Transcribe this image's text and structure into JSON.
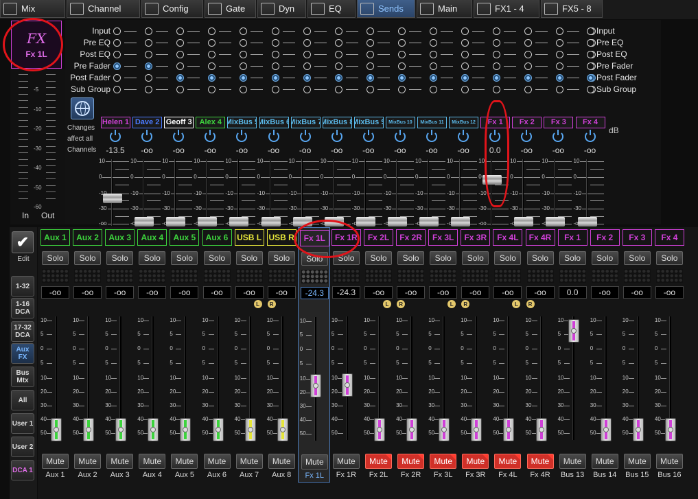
{
  "tabs": [
    {
      "label": "Mix",
      "icon": "mixer-icon"
    },
    {
      "label": "Channel",
      "icon": "channel-icon"
    },
    {
      "label": "Config",
      "icon": "input-icon"
    },
    {
      "label": "Gate",
      "icon": "gate-icon"
    },
    {
      "label": "Dyn",
      "icon": "dynamics-icon"
    },
    {
      "label": "EQ",
      "icon": "eq-icon"
    },
    {
      "label": "Sends",
      "icon": "sends-icon",
      "active": true
    },
    {
      "label": "Main",
      "icon": "main-lr-icon"
    },
    {
      "label": "FX1 - 4",
      "icon": "fx-wave-icon"
    },
    {
      "label": "FX5 - 8",
      "icon": "fx-icon"
    }
  ],
  "selected_channel": {
    "logo": "FX",
    "name": "Fx 1L"
  },
  "meter": {
    "scale": [
      "-5",
      "-10",
      "-20",
      "-30",
      "-40",
      "-50",
      "-60"
    ],
    "in_label": "In",
    "out_label": "Out"
  },
  "taps": {
    "options": [
      "Input",
      "Pre EQ",
      "Post EQ",
      "Pre Fader",
      "Post Fader",
      "Sub Group"
    ],
    "columns": [
      3,
      3,
      4,
      4,
      4,
      4,
      4,
      4,
      4,
      4,
      4,
      4,
      4,
      4,
      4,
      4
    ],
    "right_selected": 4
  },
  "changes_note": "Changes affect all Channels",
  "send_scale": [
    "10",
    "0",
    "-10",
    "-30",
    "-oo"
  ],
  "db_unit": "dB",
  "sends": [
    {
      "name": "Helen 1",
      "color": "#d040d8",
      "bus": "Bus 1",
      "value": "-13.5",
      "level": 0.42
    },
    {
      "name": "Dave 2",
      "color": "#4a7aff",
      "bus": "Bus 2",
      "value": "-oo",
      "level": 0.05
    },
    {
      "name": "Geoff 3",
      "color": "#ffffff",
      "bus": "Bus 3",
      "value": "-oo",
      "level": 0.05
    },
    {
      "name": "Alex 4",
      "color": "#3dd43d",
      "bus": "Bus 4",
      "value": "-oo",
      "level": 0.05
    },
    {
      "name": "MixBus 5",
      "color": "#5ab8e8",
      "bus": "Bus 5",
      "value": "-oo",
      "level": 0.05
    },
    {
      "name": "MixBus 6",
      "color": "#5ab8e8",
      "bus": "Bus 6",
      "value": "-oo",
      "level": 0.05
    },
    {
      "name": "MixBus 7",
      "color": "#5ab8e8",
      "bus": "Bus 7",
      "value": "-oo",
      "level": 0.05
    },
    {
      "name": "MixBus 8",
      "color": "#5ab8e8",
      "bus": "Bus 8",
      "value": "-oo",
      "level": 0.05
    },
    {
      "name": "MixBus 9",
      "color": "#5ab8e8",
      "bus": "Bus 9",
      "value": "-oo",
      "level": 0.05
    },
    {
      "name": "MixBus 10",
      "color": "#5ab8e8",
      "bus": "Bus 10",
      "value": "-oo",
      "level": 0.05
    },
    {
      "name": "MixBus 11",
      "color": "#5ab8e8",
      "bus": "Bus 11",
      "value": "-oo",
      "level": 0.05
    },
    {
      "name": "MixBus 12",
      "color": "#5ab8e8",
      "bus": "Bus 12",
      "value": "-oo",
      "level": 0.05
    },
    {
      "name": "Fx 1",
      "color": "#d040d8",
      "bus": "Bus 13",
      "value": "0.0",
      "level": 0.72
    },
    {
      "name": "Fx 2",
      "color": "#d040d8",
      "bus": "Bus 14",
      "value": "-oo",
      "level": 0.05
    },
    {
      "name": "Fx 3",
      "color": "#d040d8",
      "bus": "Bus 15",
      "value": "-oo",
      "level": 0.05
    },
    {
      "name": "Fx 4",
      "color": "#d040d8",
      "bus": "Bus 16",
      "value": "-oo",
      "level": 0.05
    }
  ],
  "sidebar": {
    "edit": "Edit",
    "buttons": [
      "1-32",
      "1-16 DCA",
      "17-32 DCA",
      "Aux FX",
      "Bus Mtx",
      "All",
      "User 1",
      "User 2",
      "DCA 1"
    ]
  },
  "fader_scale": [
    "10",
    "5",
    "0",
    "5",
    "10",
    "20",
    "30",
    "40",
    "50"
  ],
  "solo_label": "Solo",
  "mute_label": "Mute",
  "strips": [
    {
      "label": "Aux 1",
      "name": "Aux 1",
      "color": "#3dd43d",
      "value": "-oo",
      "level": 0.0,
      "bar": "#3dd43d"
    },
    {
      "label": "Aux 2",
      "name": "Aux 2",
      "color": "#3dd43d",
      "value": "-oo",
      "level": 0.0,
      "bar": "#3dd43d"
    },
    {
      "label": "Aux 3",
      "name": "Aux 3",
      "color": "#3dd43d",
      "value": "-oo",
      "level": 0.0,
      "bar": "#3dd43d"
    },
    {
      "label": "Aux 4",
      "name": "Aux 4",
      "color": "#3dd43d",
      "value": "-oo",
      "level": 0.0,
      "bar": "#3dd43d"
    },
    {
      "label": "Aux 5",
      "name": "Aux 5",
      "color": "#3dd43d",
      "value": "-oo",
      "level": 0.0,
      "bar": "#3dd43d"
    },
    {
      "label": "Aux 6",
      "name": "Aux 6",
      "color": "#3dd43d",
      "value": "-oo",
      "level": 0.0,
      "bar": "#3dd43d"
    },
    {
      "label": "USB L",
      "name": "Aux 7",
      "color": "#e6e63a",
      "value": "-oo",
      "level": 0.0,
      "bar": "#e6e63a",
      "lr": "L"
    },
    {
      "label": "USB R",
      "name": "Aux 8",
      "color": "#e6e63a",
      "value": "-oo",
      "level": 0.0,
      "bar": "#e6e63a",
      "lr": "R"
    },
    {
      "label": "Fx 1L",
      "name": "Fx 1L",
      "color": "#d040d8",
      "value": "-24.3",
      "level": 0.34,
      "bar": "#d040d8",
      "selected": true
    },
    {
      "label": "Fx 1R",
      "name": "Fx 1R",
      "color": "#d040d8",
      "value": "-24.3",
      "level": 0.34,
      "bar": "#d040d8"
    },
    {
      "label": "Fx 2L",
      "name": "Fx 2L",
      "color": "#d040d8",
      "value": "-oo",
      "level": 0.0,
      "bar": "#d040d8",
      "lr": "L",
      "muted": true
    },
    {
      "label": "Fx 2R",
      "name": "Fx 2R",
      "color": "#d040d8",
      "value": "-oo",
      "level": 0.0,
      "bar": "#d040d8",
      "lr": "R",
      "muted": true
    },
    {
      "label": "Fx 3L",
      "name": "Fx 3L",
      "color": "#d040d8",
      "value": "-oo",
      "level": 0.0,
      "bar": "#d040d8",
      "lr": "L",
      "muted": true
    },
    {
      "label": "Fx 3R",
      "name": "Fx 3R",
      "color": "#d040d8",
      "value": "-oo",
      "level": 0.0,
      "bar": "#d040d8",
      "lr": "R",
      "muted": true
    },
    {
      "label": "Fx 4L",
      "name": "Fx 4L",
      "color": "#d040d8",
      "value": "-oo",
      "level": 0.0,
      "bar": "#d040d8",
      "lr": "L",
      "muted": true
    },
    {
      "label": "Fx 4R",
      "name": "Fx 4R",
      "color": "#d040d8",
      "value": "-oo",
      "level": 0.0,
      "bar": "#d040d8",
      "lr": "R",
      "muted": true
    },
    {
      "label": "Fx 1",
      "name": "Bus 13",
      "color": "#d040d8",
      "value": "0.0",
      "level": 0.76,
      "bar": "#d040d8"
    },
    {
      "label": "Fx 2",
      "name": "Bus 14",
      "color": "#d040d8",
      "value": "-oo",
      "level": 0.0,
      "bar": "#d040d8"
    },
    {
      "label": "Fx 3",
      "name": "Bus 15",
      "color": "#d040d8",
      "value": "-oo",
      "level": 0.0,
      "bar": "#d040d8"
    },
    {
      "label": "Fx 4",
      "name": "Bus 16",
      "color": "#d040d8",
      "value": "-oo",
      "level": 0.0,
      "bar": "#d040d8"
    }
  ]
}
